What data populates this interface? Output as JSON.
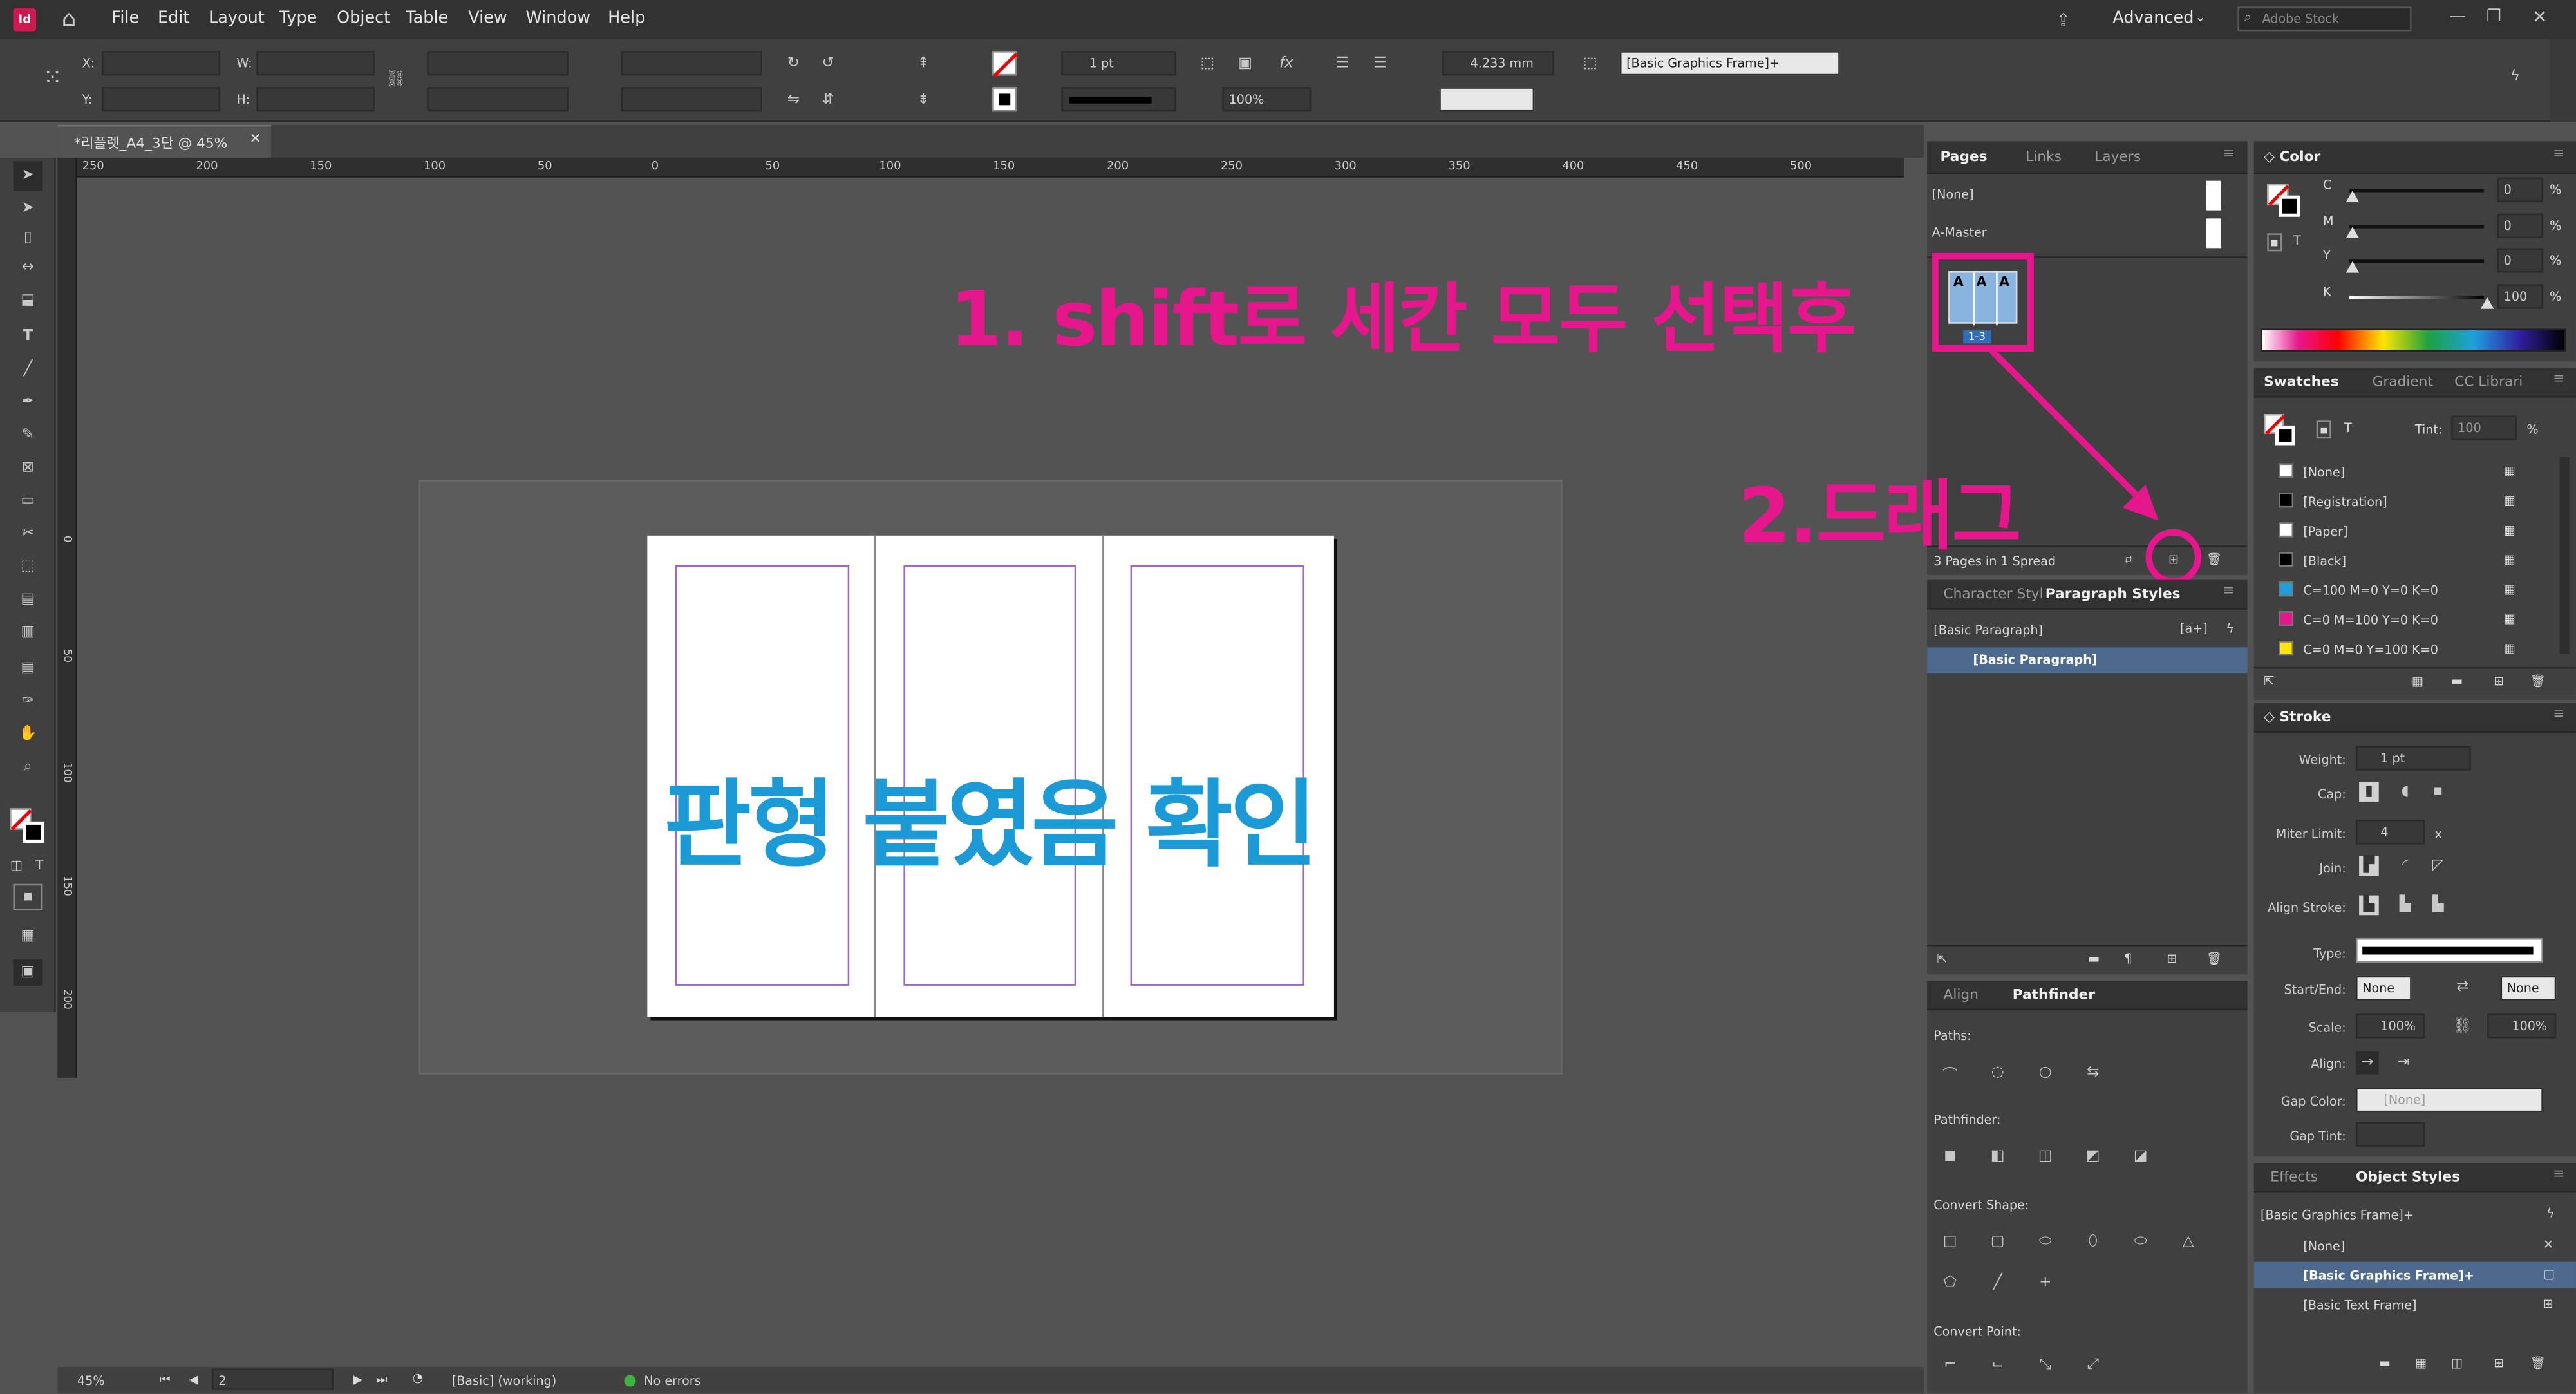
{
  "menu": {
    "logo": "Id",
    "items": [
      "File",
      "Edit",
      "Layout",
      "Type",
      "Object",
      "Table",
      "View",
      "Window",
      "Help"
    ],
    "workspace": "Advanced",
    "search_placeholder": "Adobe Stock"
  },
  "controls": {
    "x_label": "X:",
    "y_label": "Y:",
    "w_label": "W:",
    "h_label": "H:",
    "stroke_weight": "1 pt",
    "zoom_pct": "100%",
    "stroke_offset": "4.233 mm",
    "object_style": "[Basic Graphics Frame]+"
  },
  "document": {
    "tab_title": "*리플렛_A4_3단 @ 45%",
    "ruler_h": [
      "250",
      "200",
      "150",
      "100",
      "50",
      "0",
      "50",
      "100",
      "150",
      "200",
      "250",
      "300",
      "350",
      "400",
      "450",
      "500"
    ],
    "ruler_v": [
      "0",
      "50",
      "100",
      "150",
      "200"
    ],
    "overlay_text": "판형 붙였음 확인"
  },
  "status": {
    "zoom": "45%",
    "page": "2",
    "profile": "[Basic] (working)",
    "errors": "No errors"
  },
  "pages_panel": {
    "tabs": [
      "Pages",
      "Links",
      "Layers"
    ],
    "none_label": "[None]",
    "master_label": "A-Master",
    "thumb_letter": "A",
    "spread_badge": "1-3",
    "summary": "3 Pages in 1 Spread"
  },
  "annotation": {
    "step1": "1. shift로 세칸 모두 선택후",
    "step2": "2.드래그"
  },
  "paragraph_panel": {
    "tabs": [
      "Character Styl",
      "Paragraph Styles"
    ],
    "header": "[Basic Paragraph]",
    "item": "[Basic Paragraph]"
  },
  "pathfinder_panel": {
    "tabs": [
      "Align",
      "Pathfinder"
    ],
    "paths": "Paths:",
    "pathfinder": "Pathfinder:",
    "convert_shape": "Convert Shape:",
    "convert_point": "Convert Point:"
  },
  "color_panel": {
    "title": "Color",
    "channels": [
      {
        "k": "C",
        "v": "0"
      },
      {
        "k": "M",
        "v": "0"
      },
      {
        "k": "Y",
        "v": "0"
      },
      {
        "k": "K",
        "v": "100"
      }
    ],
    "pct": "%"
  },
  "swatches_panel": {
    "tabs": [
      "Swatches",
      "Gradient",
      "CC Librari"
    ],
    "tint_label": "Tint:",
    "tint": "100",
    "pct": "%",
    "items": [
      {
        "name": "[None]",
        "color": "#ffffff"
      },
      {
        "name": "[Registration]",
        "color": "#000000"
      },
      {
        "name": "[Paper]",
        "color": "#ffffff"
      },
      {
        "name": "[Black]",
        "color": "#000000"
      },
      {
        "name": "C=100 M=0 Y=0 K=0",
        "color": "#1ea0e0"
      },
      {
        "name": "C=0 M=100 Y=0 K=0",
        "color": "#e6168c"
      },
      {
        "name": "C=0 M=0 Y=100 K=0",
        "color": "#ffe600"
      }
    ]
  },
  "stroke_panel": {
    "title": "Stroke",
    "weight_label": "Weight:",
    "weight": "1 pt",
    "cap_label": "Cap:",
    "miter_label": "Miter Limit:",
    "miter": "4",
    "x": "x",
    "join_label": "Join:",
    "align_label": "Align Stroke:",
    "type_label": "Type:",
    "startend_label": "Start/End:",
    "start": "None",
    "end": "None",
    "scale_label": "Scale:",
    "scale1": "100%",
    "scale2": "100%",
    "align2_label": "Align:",
    "gapcolor_label": "Gap Color:",
    "gapcolor": "[None]",
    "gaptint_label": "Gap Tint:"
  },
  "objstyles_panel": {
    "tabs": [
      "Effects",
      "Object Styles"
    ],
    "header": "[Basic Graphics Frame]+",
    "items": [
      "[None]",
      "[Basic Graphics Frame]+",
      "[Basic Text Frame]"
    ]
  }
}
